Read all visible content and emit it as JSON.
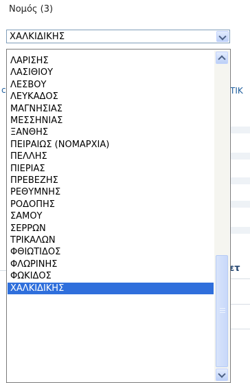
{
  "field": {
    "label": "Νομός (3)",
    "selected_value": "ΧΑΛΚΙΔΙΚΗΣ"
  },
  "background": {
    "left_fragment": "c",
    "right_fragment": "ΤΙΚ",
    "bold_fragment": "ετ"
  },
  "dropdown": {
    "options": [
      "ΛΑΡΙΣΗΣ",
      "ΛΑΣΙΘΙΟΥ",
      "ΛΕΣΒΟΥ",
      "ΛΕΥΚΑΔΟΣ",
      "ΜΑΓΝΗΣΙΑΣ",
      "ΜΕΣΣΗΝΙΑΣ",
      "ΞΑΝΘΗΣ",
      "ΠΕΙΡΑΙΩΣ (ΝΟΜΑΡΧΙΑ)",
      "ΠΕΛΛΗΣ",
      "ΠΙΕΡΙΑΣ",
      "ΠΡΕΒΕΖΗΣ",
      "ΡΕΘΥΜΝΗΣ",
      "ΡΟΔΟΠΗΣ",
      "ΣΑΜΟΥ",
      "ΣΕΡΡΩΝ",
      "ΤΡΙΚΑΛΩΝ",
      "ΦΘΙΩΤΙΔΟΣ",
      "ΦΛΩΡΙΝΗΣ",
      "ΦΩΚΙΔΟΣ",
      "ΧΑΛΚΙΔΙΚΗΣ"
    ],
    "highlighted_index": 19
  },
  "colors": {
    "highlight": "#2f6fdc",
    "link_blue": "#1c5c9b"
  },
  "icons": {
    "dropdown_arrow": "chevron-down-icon",
    "scroll_up": "chevron-up-icon",
    "scroll_down": "chevron-down-icon"
  }
}
